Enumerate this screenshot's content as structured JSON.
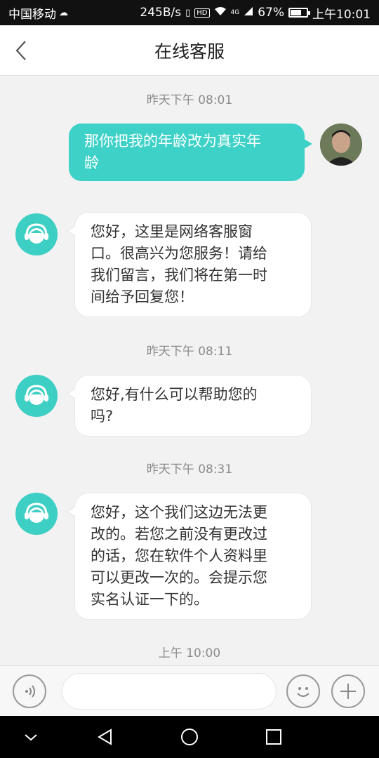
{
  "status_bar": {
    "carrier": "中国移动",
    "speed": "245B/s",
    "hd": "HD",
    "network": "4G",
    "battery": "67%",
    "battery_level": 0.67,
    "time": "上午10:01"
  },
  "header": {
    "title": "在线客服"
  },
  "messages": [
    {
      "type": "time",
      "text": "昨天下午 08:01"
    },
    {
      "type": "user",
      "lines": [
        "那你把我的年龄改为真实年",
        "龄"
      ]
    },
    {
      "type": "service",
      "lines": [
        "您好，这里是网络客服窗",
        "口。很高兴为您服务！请给",
        "我们留言，我们将在第一时",
        "间给予回复您！"
      ]
    },
    {
      "type": "time",
      "text": "昨天下午 08:11"
    },
    {
      "type": "service",
      "lines": [
        "您好,有什么可以帮助您的",
        "吗?"
      ]
    },
    {
      "type": "time",
      "text": "昨天下午 08:31"
    },
    {
      "type": "service",
      "lines": [
        "您好，这个我们这边无法更",
        "改的。若您之前没有更改过",
        "的话，您在软件个人资料里",
        "可以更改一次的。会提示您",
        "实名认证一下的。"
      ]
    },
    {
      "type": "time",
      "text": "上午 10:00"
    }
  ],
  "input_bar": {
    "value": "",
    "placeholder": ""
  },
  "icons": {
    "back": "back-arrow-icon",
    "voice": "voice-icon",
    "emoji": "emoji-icon",
    "plus": "plus-icon",
    "nav_down": "chevron-down-icon",
    "nav_back": "triangle-back-icon",
    "nav_home": "home-circle-icon",
    "nav_recent": "square-recent-icon"
  },
  "colors": {
    "accent": "#3dd1c7",
    "service_avatar": "#3ecfc4"
  }
}
